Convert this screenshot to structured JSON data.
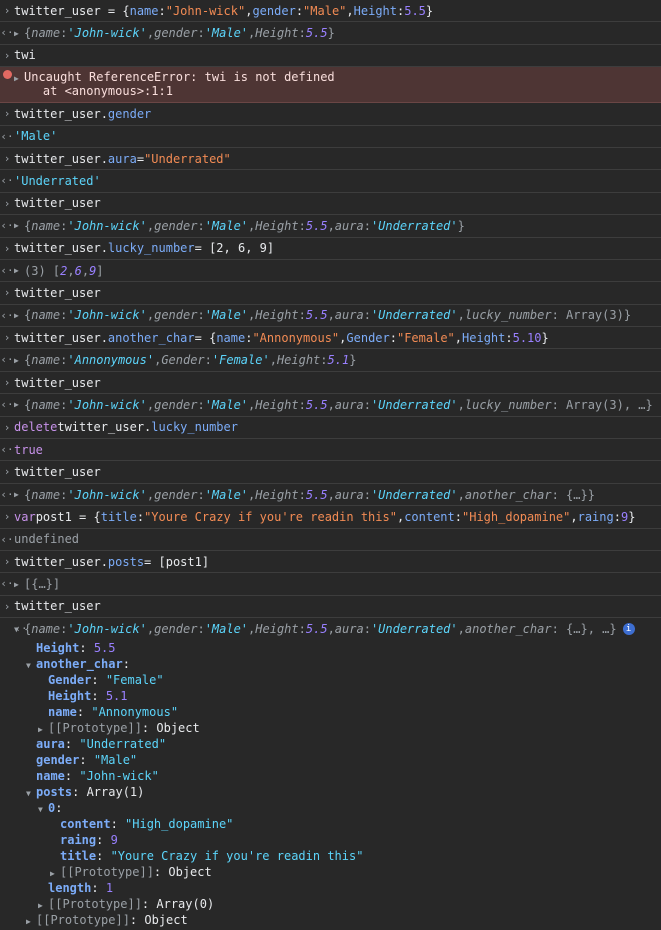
{
  "entries": [
    {
      "kind": "input",
      "tokens": [
        [
          "w",
          "twitter_user = {"
        ],
        [
          "b",
          "name"
        ],
        [
          "w",
          ": "
        ],
        [
          "s",
          "\"John-wick\""
        ],
        [
          "w",
          ", "
        ],
        [
          "b",
          "gender"
        ],
        [
          "w",
          ": "
        ],
        [
          "s",
          "\"Male\""
        ],
        [
          "w",
          ", "
        ],
        [
          "b",
          "Height"
        ],
        [
          "w",
          ": "
        ],
        [
          "n",
          "5.5"
        ],
        [
          "w",
          " }"
        ]
      ]
    },
    {
      "kind": "output",
      "tokens": [
        [
          "g",
          "{"
        ],
        [
          "p",
          "name"
        ],
        [
          "g",
          ": "
        ],
        [
          "ps",
          "'John-wick'"
        ],
        [
          "g",
          ", "
        ],
        [
          "p",
          "gender"
        ],
        [
          "g",
          ": "
        ],
        [
          "ps",
          "'Male'"
        ],
        [
          "g",
          ", "
        ],
        [
          "p",
          "Height"
        ],
        [
          "g",
          ": "
        ],
        [
          "pn",
          "5.5"
        ],
        [
          "g",
          "}"
        ]
      ],
      "expandable": true
    },
    {
      "kind": "input",
      "tokens": [
        [
          "w",
          "twi"
        ]
      ]
    },
    {
      "kind": "error",
      "line1": "Uncaught ReferenceError: twi is not defined",
      "line2": "    at <anonymous>:1:1"
    },
    {
      "kind": "input",
      "tokens": [
        [
          "w",
          "twitter_user."
        ],
        [
          "b",
          "gender"
        ]
      ]
    },
    {
      "kind": "output",
      "tokens": [
        [
          "is",
          "'Male'"
        ]
      ]
    },
    {
      "kind": "input",
      "tokens": [
        [
          "w",
          "twitter_user."
        ],
        [
          "b",
          "aura"
        ],
        [
          "w",
          " = "
        ],
        [
          "s",
          "\"Underrated\""
        ]
      ]
    },
    {
      "kind": "output",
      "tokens": [
        [
          "is",
          "'Underrated'"
        ]
      ]
    },
    {
      "kind": "input",
      "tokens": [
        [
          "w",
          "twitter_user"
        ]
      ]
    },
    {
      "kind": "output",
      "tokens": [
        [
          "g",
          "{"
        ],
        [
          "p",
          "name"
        ],
        [
          "g",
          ": "
        ],
        [
          "ps",
          "'John-wick'"
        ],
        [
          "g",
          ", "
        ],
        [
          "p",
          "gender"
        ],
        [
          "g",
          ": "
        ],
        [
          "ps",
          "'Male'"
        ],
        [
          "g",
          ", "
        ],
        [
          "p",
          "Height"
        ],
        [
          "g",
          ": "
        ],
        [
          "pn",
          "5.5"
        ],
        [
          "g",
          ", "
        ],
        [
          "p",
          "aura"
        ],
        [
          "g",
          ": "
        ],
        [
          "ps",
          "'Underrated'"
        ],
        [
          "g",
          "}"
        ]
      ],
      "expandable": true
    },
    {
      "kind": "input",
      "tokens": [
        [
          "w",
          "twitter_user."
        ],
        [
          "b",
          "lucky_number"
        ],
        [
          "w",
          " = [2, 6, 9]"
        ]
      ]
    },
    {
      "kind": "output",
      "tokens": [
        [
          "g",
          "(3) ["
        ],
        [
          "pn",
          "2"
        ],
        [
          "g",
          ", "
        ],
        [
          "pn",
          "6"
        ],
        [
          "g",
          ", "
        ],
        [
          "pn",
          "9"
        ],
        [
          "g",
          "]"
        ]
      ],
      "expandable": true
    },
    {
      "kind": "input",
      "tokens": [
        [
          "w",
          "twitter_user"
        ]
      ]
    },
    {
      "kind": "output",
      "tokens": [
        [
          "g",
          "{"
        ],
        [
          "p",
          "name"
        ],
        [
          "g",
          ": "
        ],
        [
          "ps",
          "'John-wick'"
        ],
        [
          "g",
          ", "
        ],
        [
          "p",
          "gender"
        ],
        [
          "g",
          ": "
        ],
        [
          "ps",
          "'Male'"
        ],
        [
          "g",
          ", "
        ],
        [
          "p",
          "Height"
        ],
        [
          "g",
          ": "
        ],
        [
          "pn",
          "5.5"
        ],
        [
          "g",
          ", "
        ],
        [
          "p",
          "aura"
        ],
        [
          "g",
          ": "
        ],
        [
          "ps",
          "'Underrated'"
        ],
        [
          "g",
          ", "
        ],
        [
          "p",
          "lucky_number"
        ],
        [
          "g",
          ": Array(3)}"
        ]
      ],
      "expandable": true
    },
    {
      "kind": "input",
      "tokens": [
        [
          "w",
          "twitter_user."
        ],
        [
          "b",
          "another_char"
        ],
        [
          "w",
          " = {"
        ],
        [
          "b",
          "name"
        ],
        [
          "w",
          ": "
        ],
        [
          "s",
          "\"Annonymous\""
        ],
        [
          "w",
          ", "
        ],
        [
          "b",
          "Gender"
        ],
        [
          "w",
          ": "
        ],
        [
          "s",
          "\"Female\""
        ],
        [
          "w",
          ", "
        ],
        [
          "b",
          "Height"
        ],
        [
          "w",
          ": "
        ],
        [
          "n",
          "5.10"
        ],
        [
          "w",
          "}"
        ]
      ]
    },
    {
      "kind": "output",
      "tokens": [
        [
          "g",
          "{"
        ],
        [
          "p",
          "name"
        ],
        [
          "g",
          ": "
        ],
        [
          "ps",
          "'Annonymous'"
        ],
        [
          "g",
          ", "
        ],
        [
          "p",
          "Gender"
        ],
        [
          "g",
          ": "
        ],
        [
          "ps",
          "'Female'"
        ],
        [
          "g",
          ", "
        ],
        [
          "p",
          "Height"
        ],
        [
          "g",
          ": "
        ],
        [
          "pn",
          "5.1"
        ],
        [
          "g",
          "}"
        ]
      ],
      "expandable": true
    },
    {
      "kind": "input",
      "tokens": [
        [
          "w",
          "twitter_user"
        ]
      ]
    },
    {
      "kind": "output",
      "tokens": [
        [
          "g",
          "{"
        ],
        [
          "p",
          "name"
        ],
        [
          "g",
          ": "
        ],
        [
          "ps",
          "'John-wick'"
        ],
        [
          "g",
          ", "
        ],
        [
          "p",
          "gender"
        ],
        [
          "g",
          ": "
        ],
        [
          "ps",
          "'Male'"
        ],
        [
          "g",
          ", "
        ],
        [
          "p",
          "Height"
        ],
        [
          "g",
          ": "
        ],
        [
          "pn",
          "5.5"
        ],
        [
          "g",
          ", "
        ],
        [
          "p",
          "aura"
        ],
        [
          "g",
          ": "
        ],
        [
          "ps",
          "'Underrated'"
        ],
        [
          "g",
          ", "
        ],
        [
          "p",
          "lucky_number"
        ],
        [
          "g",
          ": Array(3), …}"
        ]
      ],
      "expandable": true
    },
    {
      "kind": "input",
      "tokens": [
        [
          "k",
          "delete"
        ],
        [
          "w",
          " twitter_user."
        ],
        [
          "b",
          "lucky_number"
        ]
      ]
    },
    {
      "kind": "output",
      "tokens": [
        [
          "k",
          "true"
        ]
      ]
    },
    {
      "kind": "input",
      "tokens": [
        [
          "w",
          "twitter_user"
        ]
      ]
    },
    {
      "kind": "output",
      "tokens": [
        [
          "g",
          "{"
        ],
        [
          "p",
          "name"
        ],
        [
          "g",
          ": "
        ],
        [
          "ps",
          "'John-wick'"
        ],
        [
          "g",
          ", "
        ],
        [
          "p",
          "gender"
        ],
        [
          "g",
          ": "
        ],
        [
          "ps",
          "'Male'"
        ],
        [
          "g",
          ", "
        ],
        [
          "p",
          "Height"
        ],
        [
          "g",
          ": "
        ],
        [
          "pn",
          "5.5"
        ],
        [
          "g",
          ", "
        ],
        [
          "p",
          "aura"
        ],
        [
          "g",
          ": "
        ],
        [
          "ps",
          "'Underrated'"
        ],
        [
          "g",
          ", "
        ],
        [
          "p",
          "another_char"
        ],
        [
          "g",
          ": {…}}"
        ]
      ],
      "expandable": true
    },
    {
      "kind": "input",
      "tokens": [
        [
          "k",
          "var"
        ],
        [
          "w",
          " post1 = {"
        ],
        [
          "b",
          "title"
        ],
        [
          "w",
          ": "
        ],
        [
          "s",
          "\"Youre Crazy if you're readin this\""
        ],
        [
          "w",
          ", "
        ],
        [
          "b",
          "content"
        ],
        [
          "w",
          ": "
        ],
        [
          "s",
          "\"High_dopamine\""
        ],
        [
          "w",
          ", "
        ],
        [
          "b",
          "raing"
        ],
        [
          "w",
          ": "
        ],
        [
          "n",
          "9"
        ],
        [
          "w",
          "}"
        ]
      ]
    },
    {
      "kind": "output",
      "tokens": [
        [
          "u",
          "undefined"
        ]
      ]
    },
    {
      "kind": "input",
      "tokens": [
        [
          "w",
          "twitter_user."
        ],
        [
          "b",
          "posts"
        ],
        [
          "w",
          " = [post1]"
        ]
      ]
    },
    {
      "kind": "output",
      "tokens": [
        [
          "g",
          "[{…}]"
        ]
      ],
      "expandable": true
    },
    {
      "kind": "input",
      "tokens": [
        [
          "w",
          "twitter_user"
        ]
      ]
    }
  ],
  "tree": {
    "summary": [
      [
        "g",
        "{"
      ],
      [
        "p",
        "name"
      ],
      [
        "g",
        ": "
      ],
      [
        "ps",
        "'John-wick'"
      ],
      [
        "g",
        ", "
      ],
      [
        "p",
        "gender"
      ],
      [
        "g",
        ": "
      ],
      [
        "ps",
        "'Male'"
      ],
      [
        "g",
        ", "
      ],
      [
        "p",
        "Height"
      ],
      [
        "g",
        ": "
      ],
      [
        "pn",
        "5.5"
      ],
      [
        "g",
        ", "
      ],
      [
        "p",
        "aura"
      ],
      [
        "g",
        ": "
      ],
      [
        "ps",
        "'Underrated'"
      ],
      [
        "g",
        ", "
      ],
      [
        "p",
        "another_char"
      ],
      [
        "g",
        ": {…}, …}"
      ]
    ],
    "info_icon": "i",
    "lines": [
      {
        "indent": 1,
        "tokens": [
          [
            "bk",
            "Height"
          ],
          [
            "w",
            ": "
          ],
          [
            "n",
            "5.5"
          ]
        ]
      },
      {
        "indent": 1,
        "open": true,
        "tokens": [
          [
            "bk",
            "another_char"
          ],
          [
            "w",
            ":"
          ]
        ]
      },
      {
        "indent": 2,
        "tokens": [
          [
            "bk",
            "Gender"
          ],
          [
            "w",
            ": "
          ],
          [
            "sq",
            "\"Female\""
          ]
        ]
      },
      {
        "indent": 2,
        "tokens": [
          [
            "bk",
            "Height"
          ],
          [
            "w",
            ": "
          ],
          [
            "n",
            "5.1"
          ]
        ]
      },
      {
        "indent": 2,
        "tokens": [
          [
            "bk",
            "name"
          ],
          [
            "w",
            ": "
          ],
          [
            "sq",
            "\"Annonymous\""
          ]
        ]
      },
      {
        "indent": 2,
        "closed": true,
        "tokens": [
          [
            "gk",
            "[[Prototype]]"
          ],
          [
            "w",
            ": Object"
          ]
        ]
      },
      {
        "indent": 1,
        "tokens": [
          [
            "bk",
            "aura"
          ],
          [
            "w",
            ": "
          ],
          [
            "sq",
            "\"Underrated\""
          ]
        ]
      },
      {
        "indent": 1,
        "tokens": [
          [
            "bk",
            "gender"
          ],
          [
            "w",
            ": "
          ],
          [
            "sq",
            "\"Male\""
          ]
        ]
      },
      {
        "indent": 1,
        "tokens": [
          [
            "bk",
            "name"
          ],
          [
            "w",
            ": "
          ],
          [
            "sq",
            "\"John-wick\""
          ]
        ]
      },
      {
        "indent": 1,
        "open": true,
        "tokens": [
          [
            "bk",
            "posts"
          ],
          [
            "w",
            ": Array(1)"
          ]
        ]
      },
      {
        "indent": 2,
        "open": true,
        "tokens": [
          [
            "bk",
            "0"
          ],
          [
            "w",
            ":"
          ]
        ]
      },
      {
        "indent": 3,
        "tokens": [
          [
            "bk",
            "content"
          ],
          [
            "w",
            ": "
          ],
          [
            "sq",
            "\"High_dopamine\""
          ]
        ]
      },
      {
        "indent": 3,
        "tokens": [
          [
            "bk",
            "raing"
          ],
          [
            "w",
            ": "
          ],
          [
            "n",
            "9"
          ]
        ]
      },
      {
        "indent": 3,
        "tokens": [
          [
            "bk",
            "title"
          ],
          [
            "w",
            ": "
          ],
          [
            "sq",
            "\"Youre Crazy if you're readin this\""
          ]
        ]
      },
      {
        "indent": 3,
        "closed": true,
        "tokens": [
          [
            "gk",
            "[[Prototype]]"
          ],
          [
            "w",
            ": Object"
          ]
        ]
      },
      {
        "indent": 2,
        "tokens": [
          [
            "bk",
            "length"
          ],
          [
            "w",
            ": "
          ],
          [
            "n",
            "1"
          ]
        ]
      },
      {
        "indent": 2,
        "closed": true,
        "tokens": [
          [
            "gk",
            "[[Prototype]]"
          ],
          [
            "w",
            ": Array(0)"
          ]
        ]
      },
      {
        "indent": 1,
        "closed": true,
        "tokens": [
          [
            "gk",
            "[[Prototype]]"
          ],
          [
            "w",
            ": Object"
          ]
        ]
      }
    ]
  },
  "glyphs": {
    "prompt": "›",
    "result": "‹·",
    "closed": "▶",
    "open": "▼",
    "error": "×"
  },
  "colors": {
    "background": "#282828",
    "divider": "#3d3d3d",
    "error_bg": "#4e3534",
    "key": "#7cacf8",
    "string": "#f28b54",
    "number": "#9980ff",
    "preview_string": "#5cd5fb"
  }
}
